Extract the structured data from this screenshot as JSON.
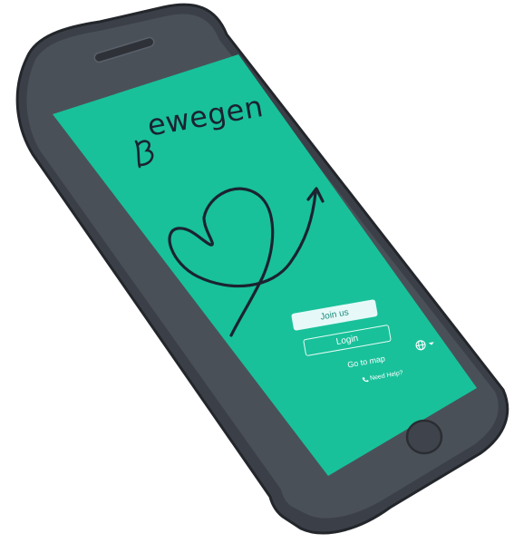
{
  "app": {
    "logo_text": "ewegen"
  },
  "actions": {
    "join_label": "Join us",
    "login_label": "Login",
    "map_label": "Go to map",
    "help_label": "Need Help?"
  },
  "colors": {
    "screen": "#18c19a",
    "phone_body": "#3b4048",
    "ink": "#1b2330",
    "join_bg": "#e6f9f8",
    "join_text": "#1a8b7b"
  },
  "icons": {
    "language": "globe-icon",
    "help": "phone-icon",
    "language_menu": "chevron-down-icon"
  }
}
